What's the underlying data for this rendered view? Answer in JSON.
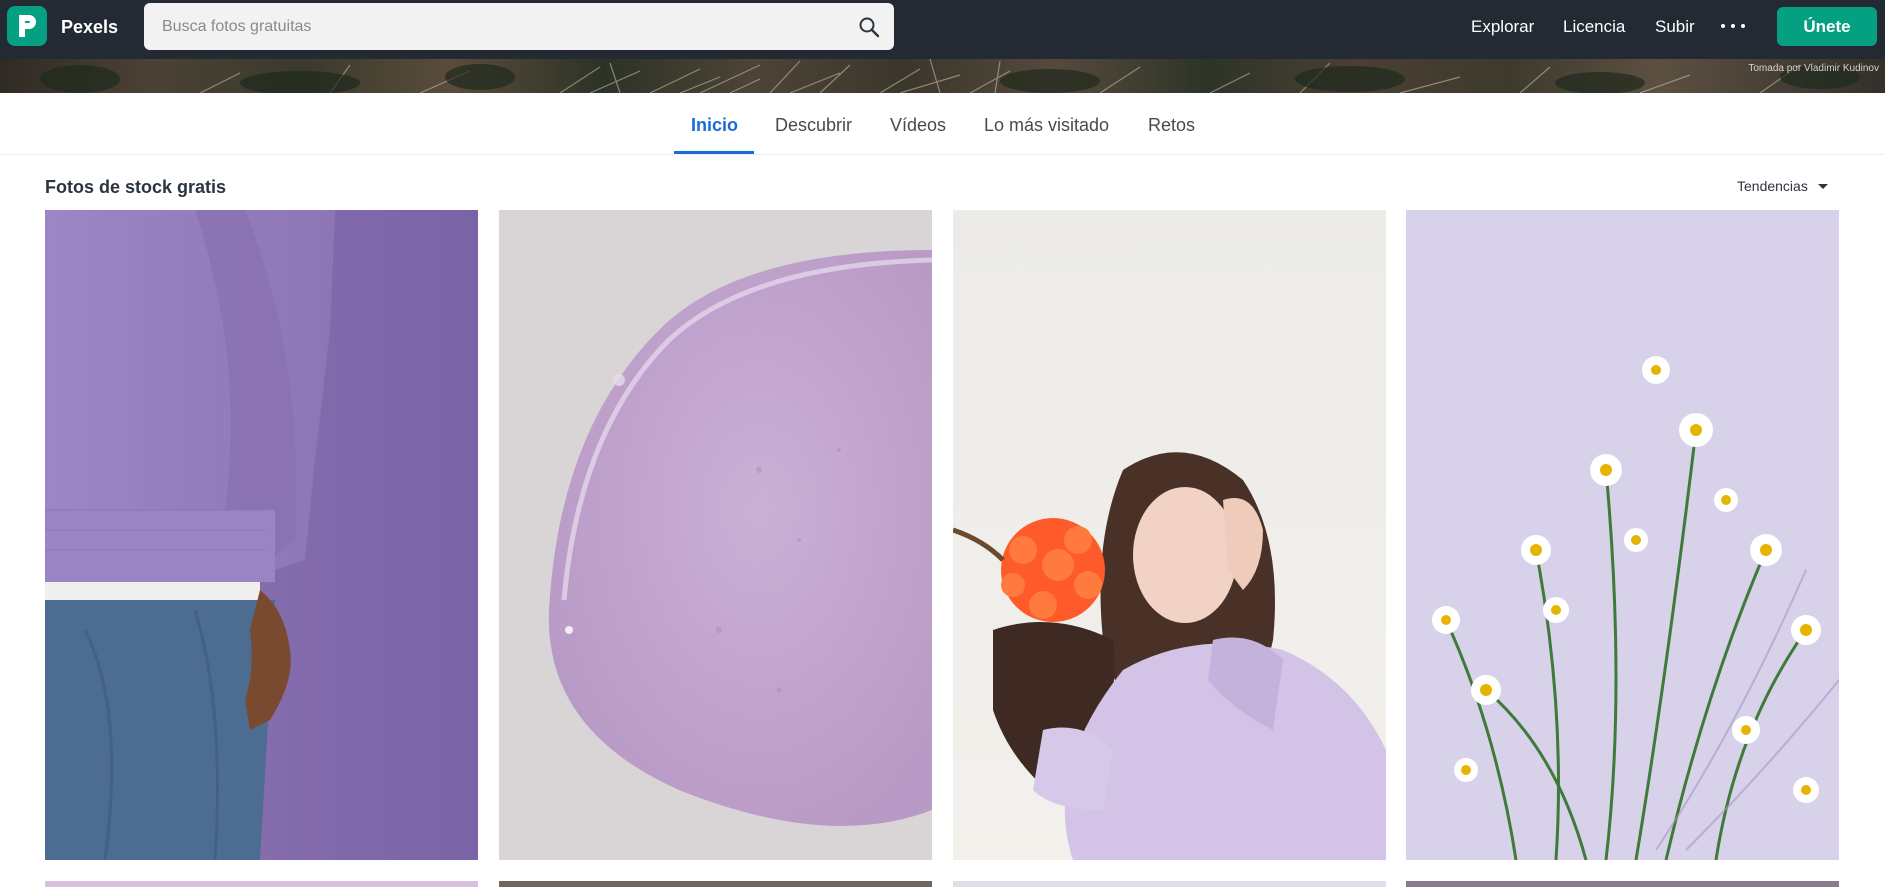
{
  "header": {
    "brand": "Pexels",
    "search_placeholder": "Busca fotos gratuitas",
    "nav": [
      "Explorar",
      "Licencia",
      "Subir"
    ],
    "join_label": "Únete"
  },
  "hero": {
    "credit": "Tomada por Vladimir Kudinov"
  },
  "tabs": [
    {
      "label": "Inicio",
      "active": true
    },
    {
      "label": "Descubrir",
      "active": false
    },
    {
      "label": "Vídeos",
      "active": false
    },
    {
      "label": "Lo más visitado",
      "active": false
    },
    {
      "label": "Retos",
      "active": false
    }
  ],
  "section": {
    "title": "Fotos de stock gratis",
    "sort_label": "Tendencias"
  },
  "colors": {
    "brand": "#05a081",
    "topbar": "#232a34",
    "active_tab": "#1b6bd6"
  },
  "photos": [
    {
      "subject": "purple hoodie and jeans"
    },
    {
      "subject": "lilac gel drop"
    },
    {
      "subject": "woman with orange flower"
    },
    {
      "subject": "white daisies on lilac"
    }
  ]
}
